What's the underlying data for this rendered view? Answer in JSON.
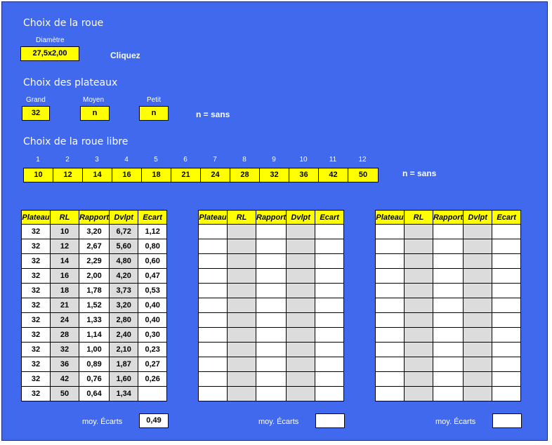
{
  "wheel": {
    "title": "Choix de la roue",
    "diameter_label": "Diamètre",
    "diameter_value": "27,5x2,00",
    "click_hint": "Cliquez"
  },
  "chainrings": {
    "title": "Choix des plateaux",
    "grand_label": "Grand",
    "grand_value": "32",
    "moyen_label": "Moyen",
    "moyen_value": "n",
    "petit_label": "Petit",
    "petit_value": "n",
    "note": "n = sans"
  },
  "freewheel": {
    "title": "Choix de la roue libre",
    "positions": [
      "1",
      "2",
      "3",
      "4",
      "5",
      "6",
      "7",
      "8",
      "9",
      "10",
      "11",
      "12"
    ],
    "values": [
      "10",
      "12",
      "14",
      "16",
      "18",
      "21",
      "24",
      "28",
      "32",
      "36",
      "42",
      "50"
    ],
    "note": "n = sans"
  },
  "tables": {
    "headers": [
      "Plateau",
      "RL",
      "Rapport",
      "Dvlpt",
      "Ecart"
    ],
    "moy_label": "moy. Écarts",
    "t1": {
      "rows": [
        [
          "32",
          "10",
          "3,20",
          "6,72",
          "1,12"
        ],
        [
          "32",
          "12",
          "2,67",
          "5,60",
          "0,80"
        ],
        [
          "32",
          "14",
          "2,29",
          "4,80",
          "0,60"
        ],
        [
          "32",
          "16",
          "2,00",
          "4,20",
          "0,47"
        ],
        [
          "32",
          "18",
          "1,78",
          "3,73",
          "0,53"
        ],
        [
          "32",
          "21",
          "1,52",
          "3,20",
          "0,40"
        ],
        [
          "32",
          "24",
          "1,33",
          "2,80",
          "0,40"
        ],
        [
          "32",
          "28",
          "1,14",
          "2,40",
          "0,30"
        ],
        [
          "32",
          "32",
          "1,00",
          "2,10",
          "0,23"
        ],
        [
          "32",
          "36",
          "0,89",
          "1,87",
          "0,27"
        ],
        [
          "32",
          "42",
          "0,76",
          "1,60",
          "0,26"
        ],
        [
          "32",
          "50",
          "0,64",
          "1,34",
          ""
        ]
      ],
      "moy_value": "0,49"
    },
    "t2": {
      "rows": [],
      "moy_value": ""
    },
    "t3": {
      "rows": [],
      "moy_value": ""
    }
  }
}
